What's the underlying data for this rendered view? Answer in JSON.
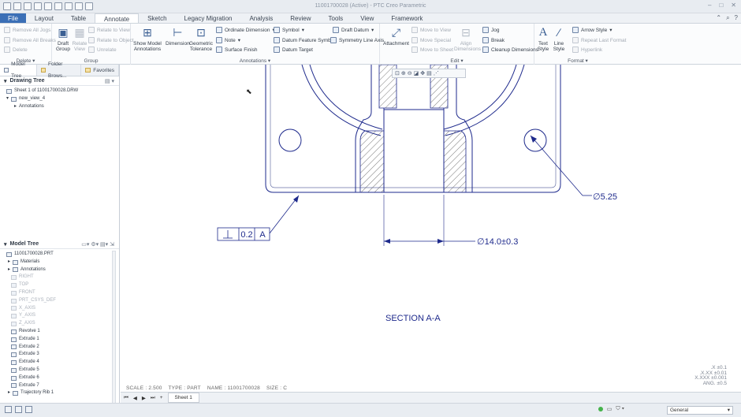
{
  "title": "11001700028 (Active) - PTC Creo Parametric",
  "tabs": [
    "File",
    "Layout",
    "Table",
    "Annotate",
    "Sketch",
    "Legacy Migration",
    "Analysis",
    "Review",
    "Tools",
    "View",
    "Framework"
  ],
  "ribbon": {
    "delete_group": {
      "label": "Delete",
      "remove_all_jogs": "Remove All Jogs",
      "remove_all_breaks": "Remove All Breaks",
      "delete": "Delete"
    },
    "group_group": {
      "label": "Group",
      "draft_group": "Draft Group",
      "relate_view": "Relate View",
      "relate_to_view": "Relate to View",
      "relate_to_object": "Relate to Object",
      "unrelate": "Unrelate"
    },
    "annotations_group": {
      "label": "Annotations",
      "show_model_annotations": "Show Model Annotations",
      "dimension": "Dimension",
      "geometric_tolerance": "Geometric Tolerance",
      "ordinate_dimension": "Ordinate Dimension",
      "note": "Note",
      "surface_finish": "Surface Finish",
      "symbol": "Symbol",
      "datum_feature_symbol": "Datum Feature Symbol",
      "datum_target": "Datum Target",
      "draft_datum": "Draft Datum",
      "symmetry_line_axis": "Symmetry Line Axis"
    },
    "edit_group": {
      "label": "Edit",
      "attachment": "Attachment",
      "move_to_view": "Move to View",
      "move_special": "Move Special",
      "move_to_sheet": "Move to Sheet",
      "align_dimensions": "Align Dimensions",
      "jog": "Jog",
      "break": "Break",
      "cleanup_dimensions": "Cleanup Dimensions"
    },
    "format_group": {
      "label": "Format",
      "text_style": "Text Style",
      "line_style": "Line Style",
      "arrow_style": "Arrow Style",
      "repeat_last_format": "Repeat Last Format",
      "hyperlink": "Hyperlink"
    }
  },
  "left_panel": {
    "tabs": [
      "Model Tree",
      "Folder Brows...",
      "Favorites"
    ],
    "drawing_tree": {
      "label": "Drawing Tree",
      "items": [
        "Sheet 1 of 11001700028.DRW",
        "new_view_4",
        "Annotations"
      ]
    },
    "model_tree": {
      "label": "Model Tree",
      "items": [
        {
          "label": "11001700028.PRT",
          "dim": false
        },
        {
          "label": "Materials",
          "dim": false
        },
        {
          "label": "Annotations",
          "dim": false
        },
        {
          "label": "RIGHT",
          "dim": true
        },
        {
          "label": "TOP",
          "dim": true
        },
        {
          "label": "FRONT",
          "dim": true
        },
        {
          "label": "PRT_CSYS_DEF",
          "dim": true
        },
        {
          "label": "X_AXIS",
          "dim": true
        },
        {
          "label": "Y_AXIS",
          "dim": true
        },
        {
          "label": "Z_AXIS",
          "dim": true
        },
        {
          "label": "Revolve 1",
          "dim": false
        },
        {
          "label": "Extrude 1",
          "dim": false
        },
        {
          "label": "Extrude 2",
          "dim": false
        },
        {
          "label": "Extrude 3",
          "dim": false
        },
        {
          "label": "Extrude 4",
          "dim": false
        },
        {
          "label": "Extrude 5",
          "dim": false
        },
        {
          "label": "Extrude 6",
          "dim": false
        },
        {
          "label": "Extrude 7",
          "dim": false
        },
        {
          "label": "Trajectory Rib 1",
          "dim": false
        }
      ]
    }
  },
  "drawing": {
    "dim_diameter_small": "∅5.25",
    "dim_diameter_large": "∅14.0±0.3",
    "gtol_value": "0.2",
    "gtol_datum": "A",
    "section_label": "SECTION  A-A",
    "tolerance_table": [
      ".X  ±0.1",
      ".X.XX  ±0.01",
      "X.XXX  ±0.001",
      "ANG.  ±0.5"
    ]
  },
  "status": {
    "scale": "SCALE : 2.500",
    "type": "TYPE : PART",
    "name": "NAME : 11001700028",
    "size": "SIZE : C"
  },
  "sheet_tab": "Sheet 1",
  "filter_value": "General"
}
